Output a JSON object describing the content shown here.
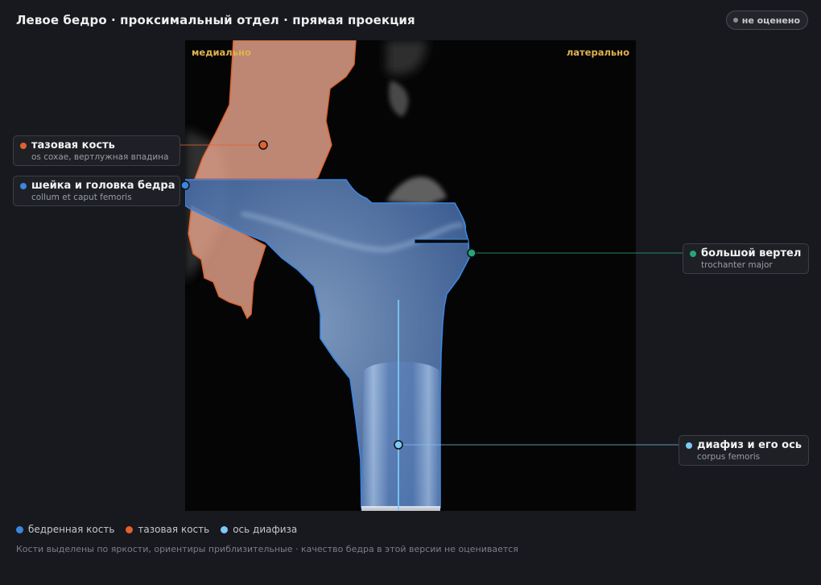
{
  "header": {
    "title": "Левое бедро · проксимальный отдел · прямая проекция",
    "status_badge": "не оценено"
  },
  "viewer": {
    "orientation_left": "медиально",
    "orientation_right": "латерально"
  },
  "annotations": [
    {
      "name": "тазовая кость",
      "latin": "os coxae, вертлужная впадина",
      "color": "#e0612e"
    },
    {
      "name": "шейка и головка бедра",
      "latin": "collum et caput femoris",
      "color": "#3b86e0"
    },
    {
      "name": "большой вертел",
      "latin": "trochanter major",
      "color": "#2aa37a"
    },
    {
      "name": "диафиз и его ось",
      "latin": "corpus femoris",
      "color": "#7ec8f5"
    }
  ],
  "legend": [
    {
      "label": "бедренная кость",
      "color": "#3b86e0"
    },
    {
      "label": "тазовая кость",
      "color": "#e0612e"
    },
    {
      "label": "ось диафиза",
      "color": "#7ec8f5"
    }
  ],
  "footnote": "Кости выделены по яркости, ориентиры приблизительные · качество бедра в этой версии не оценивается"
}
